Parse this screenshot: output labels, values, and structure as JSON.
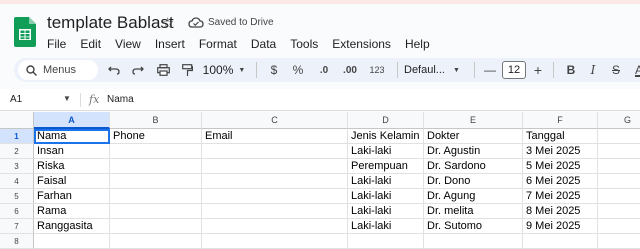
{
  "app": {
    "title": "template Bablast",
    "saved_status": "Saved to Drive"
  },
  "menu": [
    "File",
    "Edit",
    "View",
    "Insert",
    "Format",
    "Data",
    "Tools",
    "Extensions",
    "Help"
  ],
  "toolbar": {
    "search_label": "Menus",
    "zoom": "100%",
    "currency": "$",
    "percent": "%",
    "decrease_decimal": ".0",
    "increase_decimal": ".00",
    "number_format": "123",
    "font": "Defaul...",
    "font_size": "12",
    "minus": "—",
    "plus": "+",
    "bold": "B",
    "italic": "I",
    "strike": "S",
    "text_color": "A"
  },
  "formula_bar": {
    "cell_ref": "A1",
    "value": "Nama"
  },
  "columns": [
    "A",
    "B",
    "C",
    "D",
    "E",
    "F",
    "G"
  ],
  "rows": [
    "1",
    "2",
    "3",
    "4",
    "5",
    "6",
    "7",
    "8"
  ],
  "table": {
    "headers": [
      "Nama",
      "Phone",
      "Email",
      "Jenis Kelamin",
      "Dokter",
      "Tanggal"
    ],
    "records": [
      [
        "Insan",
        "",
        "",
        "Laki-laki",
        "Dr. Agustin",
        "3 Mei 2025"
      ],
      [
        "Riska",
        "",
        "",
        "Perempuan",
        "Dr. Sardono",
        "5 Mei 2025"
      ],
      [
        "Faisal",
        "",
        "",
        "Laki-laki",
        "Dr. Dono",
        "6 Mei 2025"
      ],
      [
        "Farhan",
        "",
        "",
        "Laki-laki",
        "Dr. Agung",
        "7 Mei 2025"
      ],
      [
        "Rama",
        "",
        "",
        "Laki-laki",
        "Dr. melita",
        "8 Mei 2025"
      ],
      [
        "Ranggasita",
        "",
        "",
        "Laki-laki",
        "Dr. Sutomo",
        "9 Mei 2025"
      ]
    ]
  },
  "colors": {
    "brand_green": "#0f9d58",
    "selection_blue": "#1a73e8"
  }
}
